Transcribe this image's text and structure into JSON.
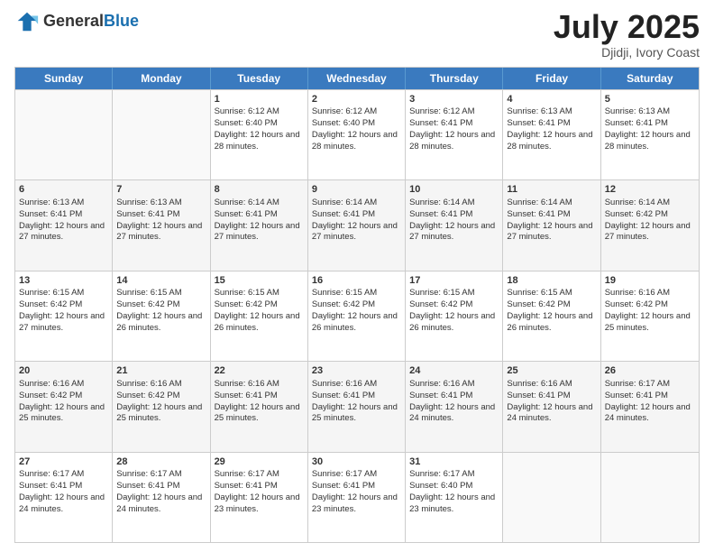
{
  "header": {
    "logo_general": "General",
    "logo_blue": "Blue",
    "title": "July 2025",
    "location": "Djidji, Ivory Coast"
  },
  "days_of_week": [
    "Sunday",
    "Monday",
    "Tuesday",
    "Wednesday",
    "Thursday",
    "Friday",
    "Saturday"
  ],
  "weeks": [
    [
      {
        "day": "",
        "info": ""
      },
      {
        "day": "",
        "info": ""
      },
      {
        "day": "1",
        "info": "Sunrise: 6:12 AM\nSunset: 6:40 PM\nDaylight: 12 hours and 28 minutes."
      },
      {
        "day": "2",
        "info": "Sunrise: 6:12 AM\nSunset: 6:40 PM\nDaylight: 12 hours and 28 minutes."
      },
      {
        "day": "3",
        "info": "Sunrise: 6:12 AM\nSunset: 6:41 PM\nDaylight: 12 hours and 28 minutes."
      },
      {
        "day": "4",
        "info": "Sunrise: 6:13 AM\nSunset: 6:41 PM\nDaylight: 12 hours and 28 minutes."
      },
      {
        "day": "5",
        "info": "Sunrise: 6:13 AM\nSunset: 6:41 PM\nDaylight: 12 hours and 28 minutes."
      }
    ],
    [
      {
        "day": "6",
        "info": "Sunrise: 6:13 AM\nSunset: 6:41 PM\nDaylight: 12 hours and 27 minutes."
      },
      {
        "day": "7",
        "info": "Sunrise: 6:13 AM\nSunset: 6:41 PM\nDaylight: 12 hours and 27 minutes."
      },
      {
        "day": "8",
        "info": "Sunrise: 6:14 AM\nSunset: 6:41 PM\nDaylight: 12 hours and 27 minutes."
      },
      {
        "day": "9",
        "info": "Sunrise: 6:14 AM\nSunset: 6:41 PM\nDaylight: 12 hours and 27 minutes."
      },
      {
        "day": "10",
        "info": "Sunrise: 6:14 AM\nSunset: 6:41 PM\nDaylight: 12 hours and 27 minutes."
      },
      {
        "day": "11",
        "info": "Sunrise: 6:14 AM\nSunset: 6:41 PM\nDaylight: 12 hours and 27 minutes."
      },
      {
        "day": "12",
        "info": "Sunrise: 6:14 AM\nSunset: 6:42 PM\nDaylight: 12 hours and 27 minutes."
      }
    ],
    [
      {
        "day": "13",
        "info": "Sunrise: 6:15 AM\nSunset: 6:42 PM\nDaylight: 12 hours and 27 minutes."
      },
      {
        "day": "14",
        "info": "Sunrise: 6:15 AM\nSunset: 6:42 PM\nDaylight: 12 hours and 26 minutes."
      },
      {
        "day": "15",
        "info": "Sunrise: 6:15 AM\nSunset: 6:42 PM\nDaylight: 12 hours and 26 minutes."
      },
      {
        "day": "16",
        "info": "Sunrise: 6:15 AM\nSunset: 6:42 PM\nDaylight: 12 hours and 26 minutes."
      },
      {
        "day": "17",
        "info": "Sunrise: 6:15 AM\nSunset: 6:42 PM\nDaylight: 12 hours and 26 minutes."
      },
      {
        "day": "18",
        "info": "Sunrise: 6:15 AM\nSunset: 6:42 PM\nDaylight: 12 hours and 26 minutes."
      },
      {
        "day": "19",
        "info": "Sunrise: 6:16 AM\nSunset: 6:42 PM\nDaylight: 12 hours and 25 minutes."
      }
    ],
    [
      {
        "day": "20",
        "info": "Sunrise: 6:16 AM\nSunset: 6:42 PM\nDaylight: 12 hours and 25 minutes."
      },
      {
        "day": "21",
        "info": "Sunrise: 6:16 AM\nSunset: 6:42 PM\nDaylight: 12 hours and 25 minutes."
      },
      {
        "day": "22",
        "info": "Sunrise: 6:16 AM\nSunset: 6:41 PM\nDaylight: 12 hours and 25 minutes."
      },
      {
        "day": "23",
        "info": "Sunrise: 6:16 AM\nSunset: 6:41 PM\nDaylight: 12 hours and 25 minutes."
      },
      {
        "day": "24",
        "info": "Sunrise: 6:16 AM\nSunset: 6:41 PM\nDaylight: 12 hours and 24 minutes."
      },
      {
        "day": "25",
        "info": "Sunrise: 6:16 AM\nSunset: 6:41 PM\nDaylight: 12 hours and 24 minutes."
      },
      {
        "day": "26",
        "info": "Sunrise: 6:17 AM\nSunset: 6:41 PM\nDaylight: 12 hours and 24 minutes."
      }
    ],
    [
      {
        "day": "27",
        "info": "Sunrise: 6:17 AM\nSunset: 6:41 PM\nDaylight: 12 hours and 24 minutes."
      },
      {
        "day": "28",
        "info": "Sunrise: 6:17 AM\nSunset: 6:41 PM\nDaylight: 12 hours and 24 minutes."
      },
      {
        "day": "29",
        "info": "Sunrise: 6:17 AM\nSunset: 6:41 PM\nDaylight: 12 hours and 23 minutes."
      },
      {
        "day": "30",
        "info": "Sunrise: 6:17 AM\nSunset: 6:41 PM\nDaylight: 12 hours and 23 minutes."
      },
      {
        "day": "31",
        "info": "Sunrise: 6:17 AM\nSunset: 6:40 PM\nDaylight: 12 hours and 23 minutes."
      },
      {
        "day": "",
        "info": ""
      },
      {
        "day": "",
        "info": ""
      }
    ]
  ]
}
